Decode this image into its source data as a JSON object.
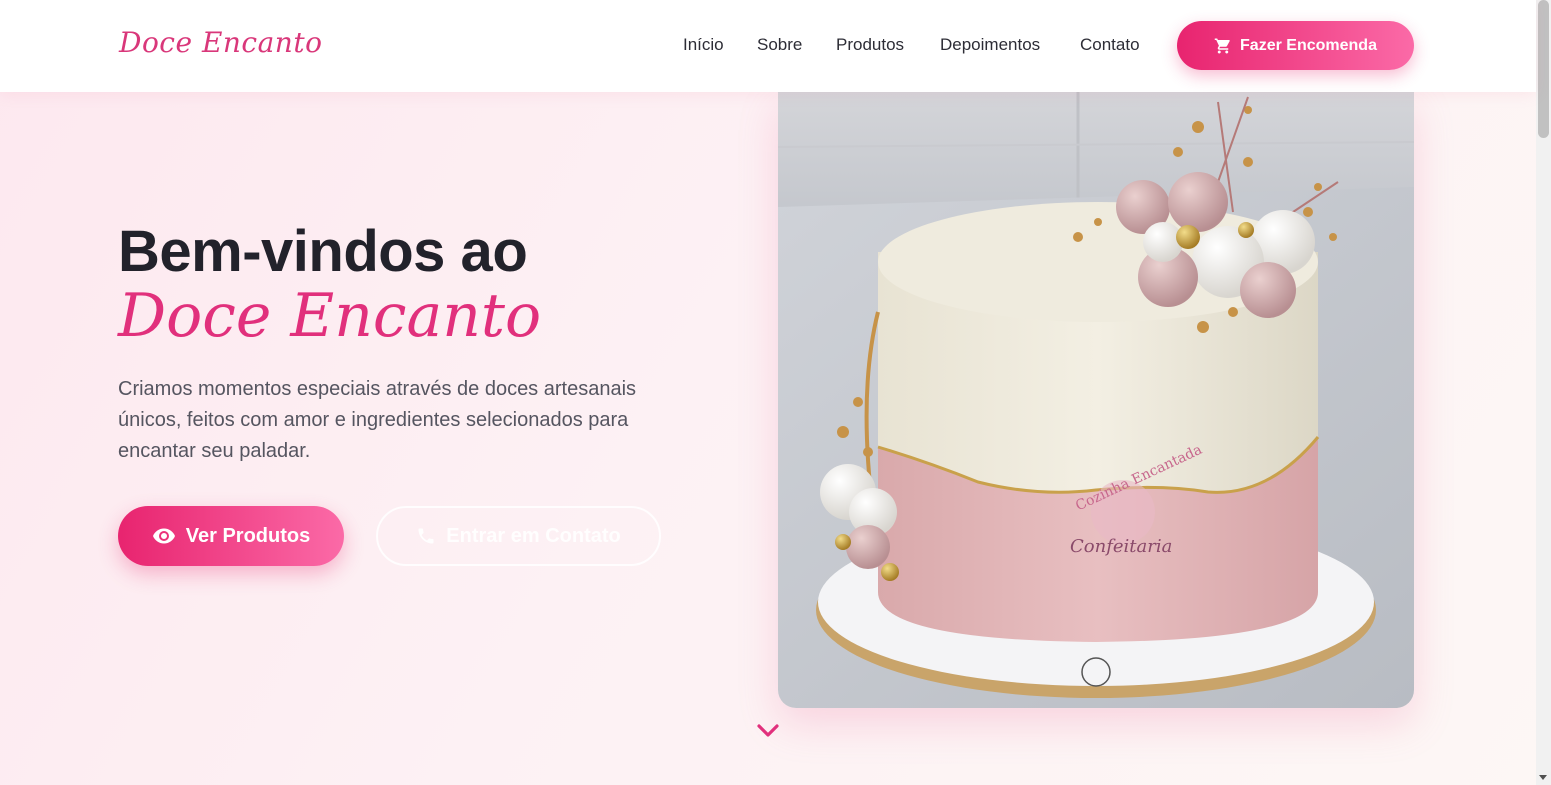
{
  "header": {
    "logo": "Doce Encanto",
    "nav": [
      "Início",
      "Sobre",
      "Produtos",
      "Depoimentos",
      "Contato"
    ],
    "order_button": "Fazer Encomenda"
  },
  "hero": {
    "title": "Bem-vindos ao",
    "script_title": "Doce Encanto",
    "description": "Criamos momentos especiais através de doces artesanais únicos, feitos com amor e ingredientes selecionados para encantar seu paladar.",
    "primary_button": "Ver Produtos",
    "secondary_button": "Entrar em Contato"
  },
  "image": {
    "watermark_top": "Cozinha Encantada",
    "watermark_bottom": "Confeitaria"
  },
  "colors": {
    "brand_pink": "#e1307c",
    "button_gradient_start": "#e8246f",
    "button_gradient_end": "#fb6aa7"
  }
}
